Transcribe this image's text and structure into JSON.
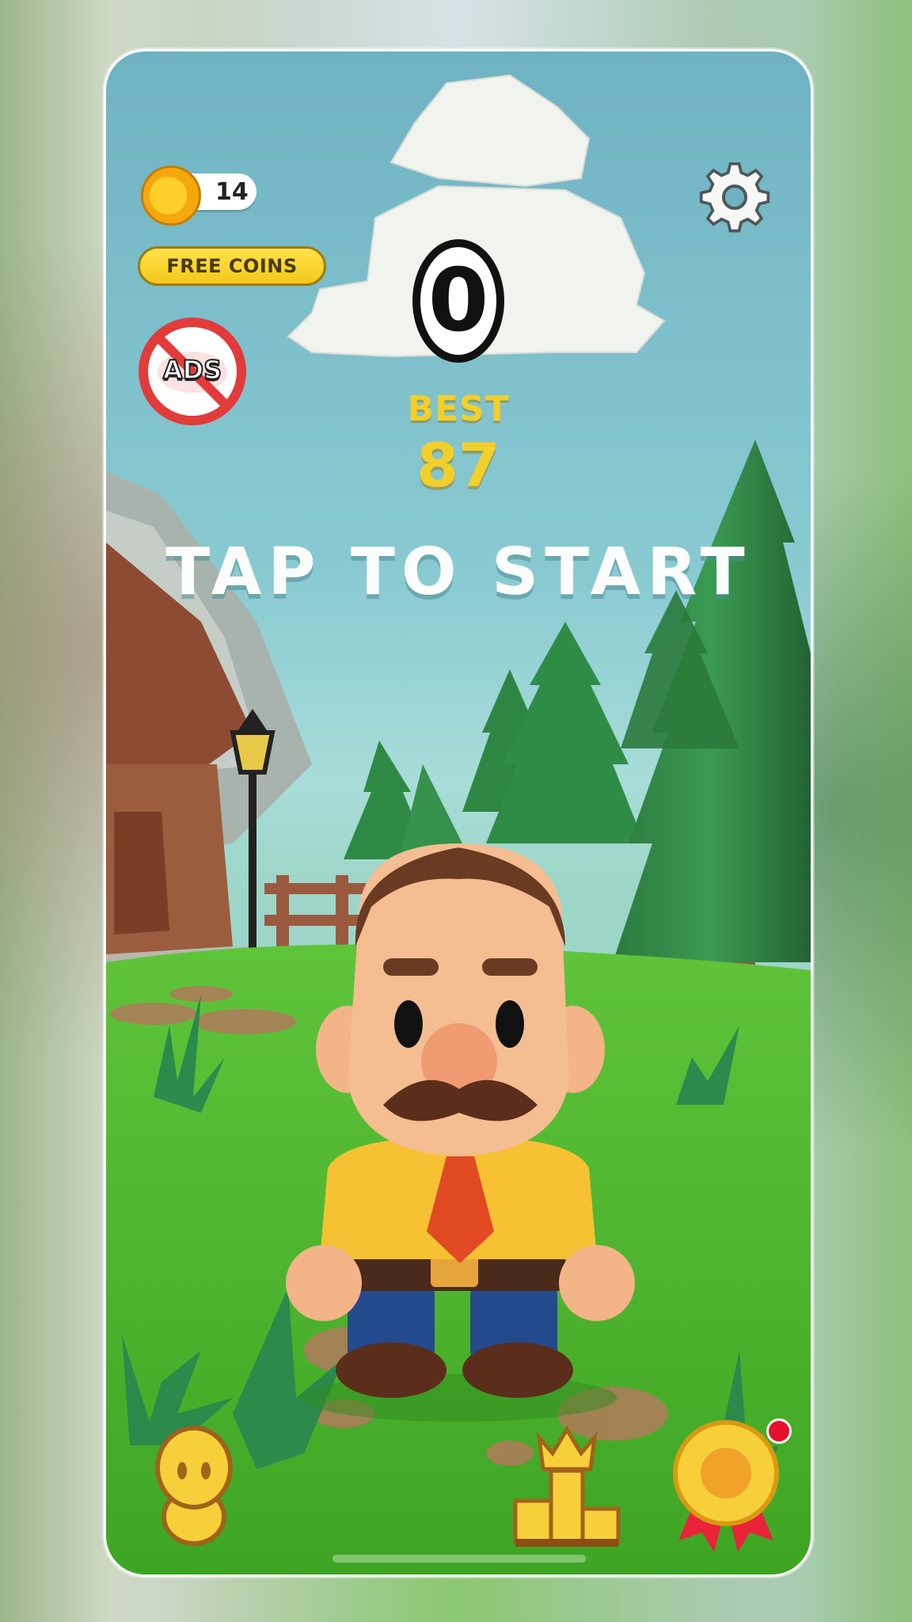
{
  "hud": {
    "coins": "14",
    "free_coins_label": "FREE COINS",
    "no_ads_label": "ADS",
    "score": "0"
  },
  "best": {
    "label": "BEST",
    "value": "87"
  },
  "prompt": "TAP TO START",
  "icons": {
    "coin": "coin-icon",
    "settings": "gear-icon",
    "no_ads": "no-ads-icon",
    "character": "character-icon",
    "leaderboard": "podium-crown-icon",
    "achievements": "award-ribbon-icon"
  },
  "colors": {
    "accent_yellow": "#f3cf2a",
    "notification_dot": "#e8112d",
    "no_ads_red": "#e23b3b"
  }
}
